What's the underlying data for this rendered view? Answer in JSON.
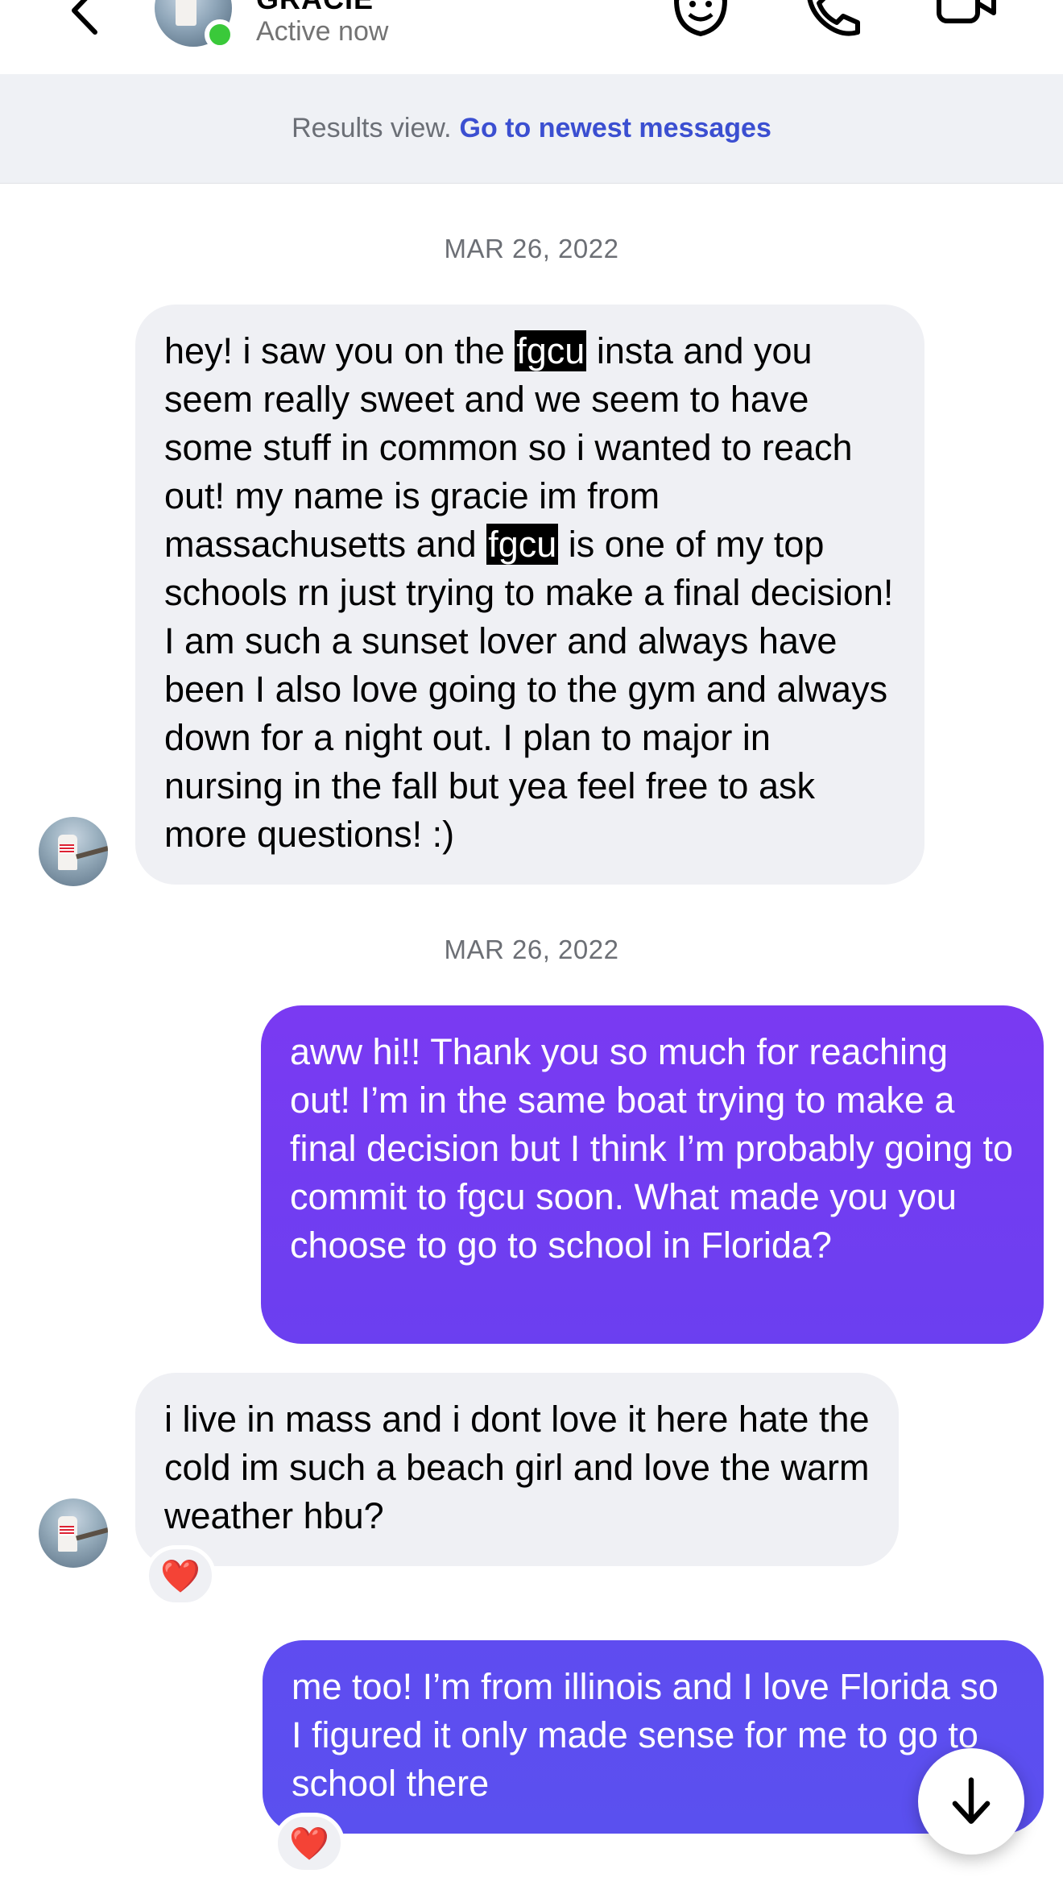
{
  "header": {
    "name": "GRACIE",
    "status": "Active now",
    "icons": [
      "back-chevron-icon",
      "sticker-icon",
      "phone-icon",
      "video-icon"
    ]
  },
  "results_bar": {
    "text": "Results view.",
    "link": "Go to newest messages"
  },
  "messages": [
    {
      "date": "MAR 26, 2022",
      "direction": "incoming",
      "parts": [
        {
          "t": "hey! i saw you on the "
        },
        {
          "t": "fgcu",
          "highlight": true
        },
        {
          "t": " insta and you seem really sweet and we seem to have some stuff in common so i wanted to reach out! my name is gracie im from massachusetts and "
        },
        {
          "t": "fgcu",
          "highlight": true
        },
        {
          "t": " is one of my top schools rn just trying to make a final decision! I am such a sunset lover and always have been I also love going to the gym and always down for a night out. I plan to major in nursing in the fall but yea feel free to ask more questions! :)"
        }
      ]
    },
    {
      "date": "MAR 26, 2022",
      "direction": "outgoing",
      "text": "aww hi!! Thank you so much for reaching out! I’m in the same boat trying to make a final decision but I think I’m probably going to commit to fgcu soon. What made you you choose to go to school in Florida?"
    },
    {
      "direction": "incoming",
      "text": "i live in mass and i dont love it here hate the cold im such a beach girl and love the warm weather hbu?",
      "reaction": "❤️"
    },
    {
      "direction": "outgoing",
      "text": "me too! I’m from illinois and I love Florida so I figured it only made sense for me to go to school there",
      "reaction": "❤️"
    }
  ],
  "colors": {
    "outgoing_1": "#7a3af2",
    "outgoing_2": "#5a4ff0",
    "incoming": "#eff0f4",
    "link": "#3b4fd1",
    "online": "#3ac93a"
  },
  "scroll_button": {
    "icon": "arrow-down-icon"
  }
}
